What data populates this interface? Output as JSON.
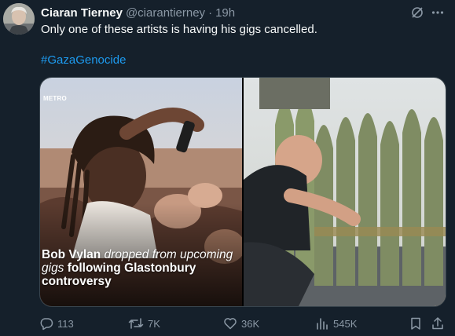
{
  "author": {
    "display_name": "Ciaran Tierney",
    "handle": "@ciarantierney",
    "separator": "·",
    "time": "19h"
  },
  "tweet": {
    "text": "Only one of these artists is having his gigs cancelled.",
    "hashtag": "#GazaGenocide"
  },
  "media": {
    "left_image": {
      "watermark": "METRO",
      "caption_parts": [
        {
          "text": "Bob Vylan ",
          "style": "bold"
        },
        {
          "text": "dropped from upcoming gigs ",
          "style": "italic"
        },
        {
          "text": "following Glastonbury controversy",
          "style": "bold"
        }
      ]
    }
  },
  "actions": {
    "replies": "113",
    "reposts": "7K",
    "likes": "36K",
    "views": "545K"
  },
  "colors": {
    "background": "#15202b",
    "text_primary": "#f7f9f9",
    "text_secondary": "#8b98a5",
    "link": "#1d9bf0",
    "border": "#38444d"
  },
  "icons": {
    "avatar": "avatar-photo",
    "grok": "grok-icon",
    "more": "more-icon",
    "reply": "reply-icon",
    "repost": "repost-icon",
    "like": "heart-icon",
    "views": "views-icon",
    "bookmark": "bookmark-icon",
    "share": "share-icon"
  }
}
